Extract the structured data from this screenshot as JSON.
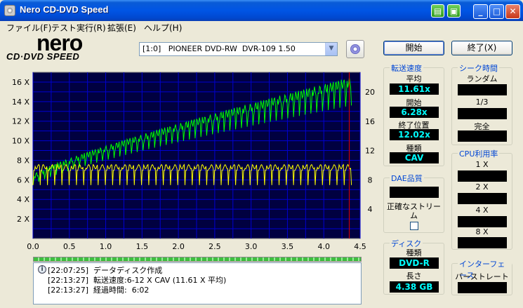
{
  "window": {
    "title": "Nero CD-DVD Speed"
  },
  "menu": [
    {
      "label": "ファイル(F)"
    },
    {
      "label": "テスト実行(R)"
    },
    {
      "label": "拡張(E)"
    },
    {
      "label": "ヘルプ(H)"
    }
  ],
  "logo": {
    "main": "nero",
    "sub": "CD·DVD SPEED"
  },
  "drive": {
    "selected": "[1:0]   PIONEER DVD-RW  DVR-109 1.50"
  },
  "buttons": {
    "start": "開始",
    "exit": "終了(X)"
  },
  "chart_data": {
    "type": "line",
    "x_ticks": [
      "0.0",
      "0.5",
      "1.0",
      "1.5",
      "2.0",
      "2.5",
      "3.0",
      "3.5",
      "4.0",
      "4.5"
    ],
    "xlim": [
      0,
      4.5
    ],
    "y_left_ticks": [
      "2 X",
      "4 X",
      "6 X",
      "8 X",
      "10 X",
      "12 X",
      "14 X",
      "16 X"
    ],
    "ylim_left": [
      0,
      17
    ],
    "y_right_ticks": [
      "4",
      "8",
      "12",
      "16",
      "20"
    ],
    "ylim_right": [
      0,
      22.7
    ],
    "grid": true,
    "marker_x": 4.35,
    "series": [
      {
        "color": "#00ff00",
        "axis": "left",
        "start_x": 0.0,
        "end_x": 4.38,
        "start_y": 6.28,
        "end_y": 16.0
      },
      {
        "color": "#ffff00",
        "axis": "right",
        "start_x": 0.0,
        "end_x": 4.38,
        "mean_y": 8.9
      }
    ]
  },
  "log": [
    {
      "time": "[22:07:25]",
      "text": "データディスク作成"
    },
    {
      "time": "[22:13:27]",
      "text": "転送速度:6-12 X CAV (11.61 X 平均)"
    },
    {
      "time": "[22:13:27]",
      "text": "経過時間:  6:02"
    }
  ],
  "transfer": {
    "title": "転送速度",
    "avg_label": "平均",
    "avg": "11.61x",
    "start_label": "開始",
    "start": "6.28x",
    "end_label": "終了位置",
    "end": "12.02x",
    "type_label": "種類",
    "type": "CAV"
  },
  "seek": {
    "title": "シーク時間",
    "random_label": "ランダム",
    "random": "",
    "third_label": "1/3",
    "third": "",
    "full_label": "完全",
    "full": ""
  },
  "dae": {
    "title": "DAE品質",
    "value": "",
    "accurate_label": "正確なストリー\nム"
  },
  "cpu": {
    "title": "CPU利用率",
    "x1_label": "1 X",
    "x2_label": "2 X",
    "x4_label": "4 X",
    "x8_label": "8 X"
  },
  "disc": {
    "title": "ディスク",
    "type_label": "種類",
    "type": "DVD-R",
    "length_label": "長さ",
    "length": "4.38 GB"
  },
  "interface": {
    "title": "インターフェース",
    "burst_label": "バーストレート",
    "burst": ""
  }
}
